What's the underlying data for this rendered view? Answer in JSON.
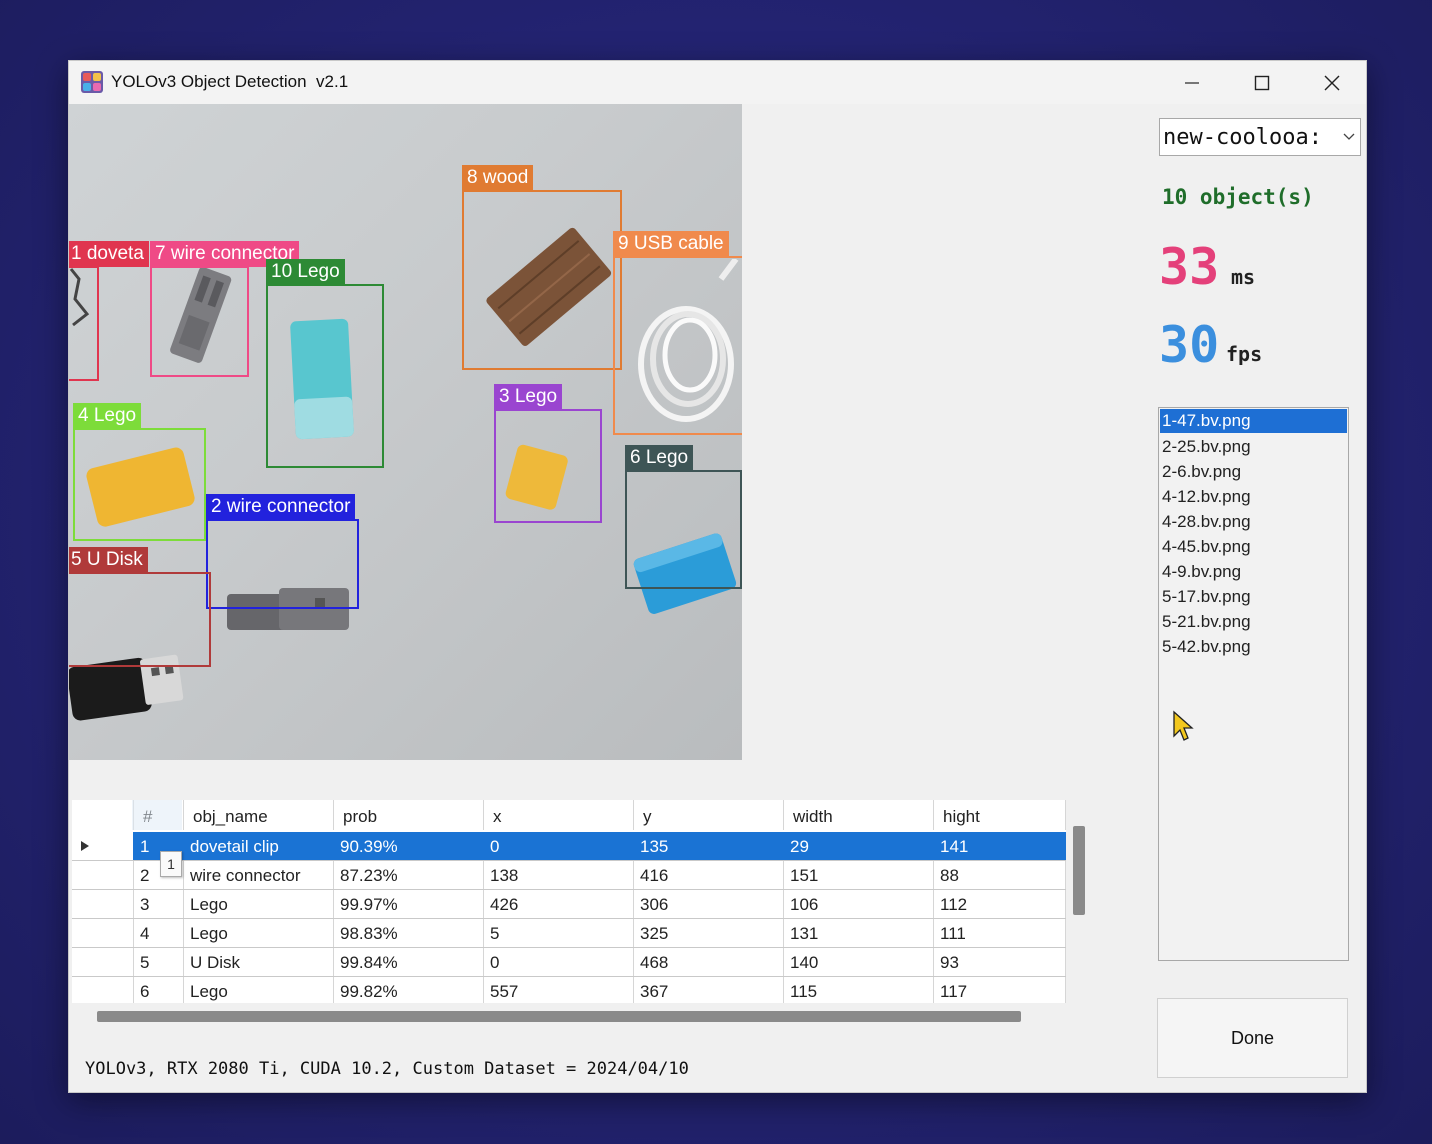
{
  "window": {
    "title": "YOLOv3 Object Detection  v2.1",
    "controls": {
      "minimize": "minimize-icon",
      "maximize": "maximize-icon",
      "close": "close-icon"
    }
  },
  "image_view": {
    "detections": [
      {
        "label": "1 doveta",
        "color": "#e0354f"
      },
      {
        "label": "7 wire connector",
        "color": "#ef4a86"
      },
      {
        "label": "10 Lego",
        "color": "#2d8a35"
      },
      {
        "label": "8 wood",
        "color": "#e07b32"
      },
      {
        "label": "9 USB cable",
        "color": "#f08a4c"
      },
      {
        "label": "3 Lego",
        "color": "#9a45d0"
      },
      {
        "label": "4 Lego",
        "color": "#7ddc3a"
      },
      {
        "label": "6 Lego",
        "color": "#3e5556"
      },
      {
        "label": "2 wire connector",
        "color": "#2222dd"
      },
      {
        "label": "5 U Disk",
        "color": "#b03a3a"
      }
    ]
  },
  "side_panel": {
    "model_select": "new-coolooa:",
    "object_count": "10 object(s)",
    "latency_value": "33",
    "latency_unit": "ms",
    "fps_value": "30",
    "fps_unit": "fps",
    "files": [
      "1-47.bv.png",
      "2-25.bv.png",
      "2-6.bv.png",
      "4-12.bv.png",
      "4-28.bv.png",
      "4-45.bv.png",
      "4-9.bv.png",
      "5-17.bv.png",
      "5-21.bv.png",
      "5-42.bv.png"
    ],
    "selected_file": "1-47.bv.png",
    "done_label": "Done"
  },
  "table": {
    "columns": [
      "#",
      "obj_name",
      "prob",
      "x",
      "y",
      "width",
      "hight"
    ],
    "rows": [
      [
        "1",
        "dovetail clip",
        "90.39%",
        "0",
        "135",
        "29",
        "141"
      ],
      [
        "2",
        "wire connector",
        "87.23%",
        "138",
        "416",
        "151",
        "88"
      ],
      [
        "3",
        "Lego",
        "99.97%",
        "426",
        "306",
        "106",
        "112"
      ],
      [
        "4",
        "Lego",
        "98.83%",
        "5",
        "325",
        "131",
        "111"
      ],
      [
        "5",
        "U Disk",
        "99.84%",
        "0",
        "468",
        "140",
        "93"
      ],
      [
        "6",
        "Lego",
        "99.82%",
        "557",
        "367",
        "115",
        "117"
      ]
    ],
    "tooltip": "1"
  },
  "status_bar": "YOLOv3, RTX 2080 Ti, CUDA 10.2, Custom Dataset = 2024/04/10"
}
